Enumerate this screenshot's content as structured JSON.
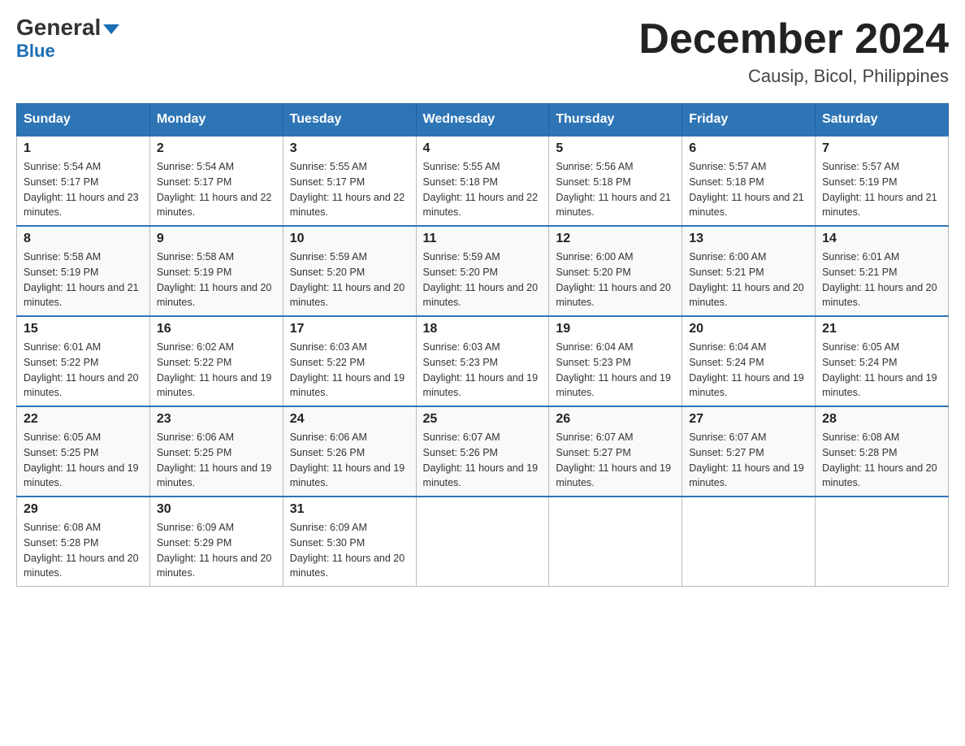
{
  "header": {
    "logo_main": "General",
    "logo_arrow": "▶",
    "logo_sub": "Blue",
    "month_title": "December 2024",
    "subtitle": "Causip, Bicol, Philippines"
  },
  "days_of_week": [
    "Sunday",
    "Monday",
    "Tuesday",
    "Wednesday",
    "Thursday",
    "Friday",
    "Saturday"
  ],
  "weeks": [
    [
      {
        "day": 1,
        "sunrise": "5:54 AM",
        "sunset": "5:17 PM",
        "daylight": "11 hours and 23 minutes."
      },
      {
        "day": 2,
        "sunrise": "5:54 AM",
        "sunset": "5:17 PM",
        "daylight": "11 hours and 22 minutes."
      },
      {
        "day": 3,
        "sunrise": "5:55 AM",
        "sunset": "5:17 PM",
        "daylight": "11 hours and 22 minutes."
      },
      {
        "day": 4,
        "sunrise": "5:55 AM",
        "sunset": "5:18 PM",
        "daylight": "11 hours and 22 minutes."
      },
      {
        "day": 5,
        "sunrise": "5:56 AM",
        "sunset": "5:18 PM",
        "daylight": "11 hours and 21 minutes."
      },
      {
        "day": 6,
        "sunrise": "5:57 AM",
        "sunset": "5:18 PM",
        "daylight": "11 hours and 21 minutes."
      },
      {
        "day": 7,
        "sunrise": "5:57 AM",
        "sunset": "5:19 PM",
        "daylight": "11 hours and 21 minutes."
      }
    ],
    [
      {
        "day": 8,
        "sunrise": "5:58 AM",
        "sunset": "5:19 PM",
        "daylight": "11 hours and 21 minutes."
      },
      {
        "day": 9,
        "sunrise": "5:58 AM",
        "sunset": "5:19 PM",
        "daylight": "11 hours and 20 minutes."
      },
      {
        "day": 10,
        "sunrise": "5:59 AM",
        "sunset": "5:20 PM",
        "daylight": "11 hours and 20 minutes."
      },
      {
        "day": 11,
        "sunrise": "5:59 AM",
        "sunset": "5:20 PM",
        "daylight": "11 hours and 20 minutes."
      },
      {
        "day": 12,
        "sunrise": "6:00 AM",
        "sunset": "5:20 PM",
        "daylight": "11 hours and 20 minutes."
      },
      {
        "day": 13,
        "sunrise": "6:00 AM",
        "sunset": "5:21 PM",
        "daylight": "11 hours and 20 minutes."
      },
      {
        "day": 14,
        "sunrise": "6:01 AM",
        "sunset": "5:21 PM",
        "daylight": "11 hours and 20 minutes."
      }
    ],
    [
      {
        "day": 15,
        "sunrise": "6:01 AM",
        "sunset": "5:22 PM",
        "daylight": "11 hours and 20 minutes."
      },
      {
        "day": 16,
        "sunrise": "6:02 AM",
        "sunset": "5:22 PM",
        "daylight": "11 hours and 19 minutes."
      },
      {
        "day": 17,
        "sunrise": "6:03 AM",
        "sunset": "5:22 PM",
        "daylight": "11 hours and 19 minutes."
      },
      {
        "day": 18,
        "sunrise": "6:03 AM",
        "sunset": "5:23 PM",
        "daylight": "11 hours and 19 minutes."
      },
      {
        "day": 19,
        "sunrise": "6:04 AM",
        "sunset": "5:23 PM",
        "daylight": "11 hours and 19 minutes."
      },
      {
        "day": 20,
        "sunrise": "6:04 AM",
        "sunset": "5:24 PM",
        "daylight": "11 hours and 19 minutes."
      },
      {
        "day": 21,
        "sunrise": "6:05 AM",
        "sunset": "5:24 PM",
        "daylight": "11 hours and 19 minutes."
      }
    ],
    [
      {
        "day": 22,
        "sunrise": "6:05 AM",
        "sunset": "5:25 PM",
        "daylight": "11 hours and 19 minutes."
      },
      {
        "day": 23,
        "sunrise": "6:06 AM",
        "sunset": "5:25 PM",
        "daylight": "11 hours and 19 minutes."
      },
      {
        "day": 24,
        "sunrise": "6:06 AM",
        "sunset": "5:26 PM",
        "daylight": "11 hours and 19 minutes."
      },
      {
        "day": 25,
        "sunrise": "6:07 AM",
        "sunset": "5:26 PM",
        "daylight": "11 hours and 19 minutes."
      },
      {
        "day": 26,
        "sunrise": "6:07 AM",
        "sunset": "5:27 PM",
        "daylight": "11 hours and 19 minutes."
      },
      {
        "day": 27,
        "sunrise": "6:07 AM",
        "sunset": "5:27 PM",
        "daylight": "11 hours and 19 minutes."
      },
      {
        "day": 28,
        "sunrise": "6:08 AM",
        "sunset": "5:28 PM",
        "daylight": "11 hours and 20 minutes."
      }
    ],
    [
      {
        "day": 29,
        "sunrise": "6:08 AM",
        "sunset": "5:28 PM",
        "daylight": "11 hours and 20 minutes."
      },
      {
        "day": 30,
        "sunrise": "6:09 AM",
        "sunset": "5:29 PM",
        "daylight": "11 hours and 20 minutes."
      },
      {
        "day": 31,
        "sunrise": "6:09 AM",
        "sunset": "5:30 PM",
        "daylight": "11 hours and 20 minutes."
      },
      null,
      null,
      null,
      null
    ]
  ]
}
